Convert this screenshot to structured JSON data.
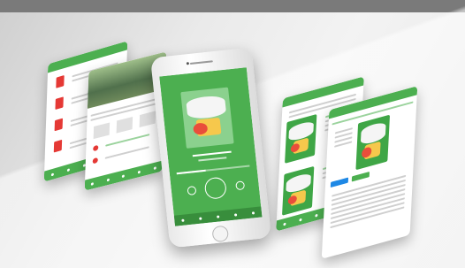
{
  "scene": {
    "description_colors": {
      "brand_green": "#4caf50",
      "pdf_red": "#e53935",
      "book_yellow": "#f6c84c"
    },
    "cards": [
      {
        "id": "files",
        "header": "",
        "nav_icons": 5
      },
      {
        "id": "player-detail",
        "header": "",
        "nav_icons": 5
      },
      {
        "id": "phone-player",
        "header": "",
        "nav_icons": 5
      },
      {
        "id": "book-list",
        "header": "",
        "nav_icons": 5
      },
      {
        "id": "book-detail",
        "header": "",
        "nav_icons": 5
      }
    ]
  }
}
